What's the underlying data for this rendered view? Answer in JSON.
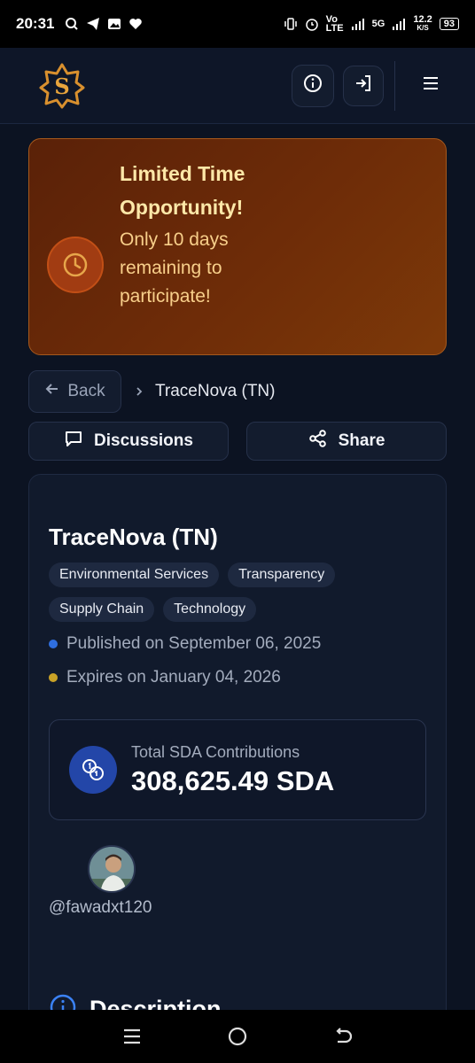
{
  "status_bar": {
    "time": "20:31",
    "network": "5G",
    "speed_value": "12.2",
    "speed_unit": "K/S",
    "volte_top": "Vo",
    "volte_bottom": "LTE",
    "battery": "93"
  },
  "header": {
    "logo_icon": "brand-logo",
    "info_icon": "info-icon",
    "login_icon": "login-icon",
    "menu_icon": "menu-icon"
  },
  "promo": {
    "title": "Limited Time Opportunity!",
    "subtitle": "Only 10 days remaining to participate!",
    "icon": "clock-icon"
  },
  "breadcrumb": {
    "back_label": "Back",
    "current": "TraceNova (TN)"
  },
  "actions": {
    "discussions_label": "Discussions",
    "share_label": "Share"
  },
  "project": {
    "title": "TraceNova (TN)",
    "tags": [
      "Environmental Services",
      "Transparency",
      "Supply Chain",
      "Technology"
    ],
    "published": "Published on September 06, 2025",
    "expires": "Expires on January 04, 2026",
    "contributions_label": "Total SDA Contributions",
    "contributions_value": "308,625.49 SDA",
    "creator_handle": "@fawadxt120",
    "section_title": "Description"
  },
  "colors": {
    "published_dot": "#2f6fe0",
    "expires_dot": "#c9a227",
    "accent_blue": "#2346a8",
    "promo_text": "#fde8a8"
  }
}
